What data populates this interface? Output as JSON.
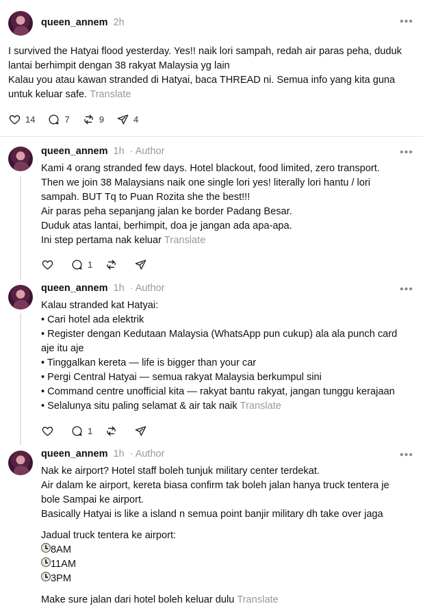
{
  "posts": [
    {
      "username": "queen_annem",
      "time": "2h",
      "author": "",
      "lines": [
        "I survived the Hatyai flood yesterday. Yes!! naik lori sampah, redah air paras peha, duduk",
        "lantai berhimpit dengan 38 rakyat Malaysia yg lain",
        "Kalau you atau kawan stranded di Hatyai, baca THREAD ni. Semua info yang kita guna",
        "untuk keluar safe."
      ],
      "translate": "Translate",
      "counts": {
        "likes": "14",
        "replies": "7",
        "reposts": "9",
        "shares": "4"
      }
    },
    {
      "username": "queen_annem",
      "time": "1h",
      "author": "· Author",
      "lines": [
        "Kami 4 orang stranded few days. Hotel blackout, food limited, zero transport.",
        "Then we join 38 Malaysians naik one single lori yes! literally lori hantu / lori",
        "sampah. BUT Tq to Puan Rozita she the best!!!",
        "Air paras peha sepanjang jalan ke border Padang Besar.",
        "Duduk atas lantai, berhimpit, doa je jangan ada apa-apa.",
        "Ini step pertama nak keluar"
      ],
      "translate": "Translate",
      "counts": {
        "likes": "",
        "replies": "1",
        "reposts": "",
        "shares": ""
      }
    },
    {
      "username": "queen_annem",
      "time": "1h",
      "author": "· Author",
      "lines": [
        "Kalau stranded kat Hatyai:",
        "• Cari hotel ada elektrik",
        "• Register dengan Kedutaan Malaysia (WhatsApp pun cukup) ala ala punch card",
        "aje itu aje",
        "• Tinggalkan kereta — life is bigger than your car",
        "• Pergi Central Hatyai — semua rakyat Malaysia berkumpul sini",
        "• Command centre unofficial kita — rakyat bantu rakyat, jangan tunggu kerajaan",
        "• Selalunya situ paling selamat & air tak naik"
      ],
      "translate": "Translate",
      "counts": {
        "likes": "",
        "replies": "1",
        "reposts": "",
        "shares": ""
      }
    },
    {
      "username": "queen_annem",
      "time": "1h",
      "author": "· Author",
      "lines": [
        "Nak ke airport? Hotel staff boleh tunjuk military center terdekat.",
        "Air dalam ke airport, kereta biasa confirm tak boleh jalan hanya truck tentera je",
        "bole Sampai ke airport.",
        "Basically Hatyai is like a island n semua point banjir military dh take over jaga"
      ],
      "schedule_title": "Jadual truck tentera ke airport:",
      "schedule": [
        "8AM",
        "11AM",
        "3PM"
      ],
      "footer_line": "Make sure jalan dari hotel boleh keluar dulu",
      "translate": "Translate"
    }
  ]
}
